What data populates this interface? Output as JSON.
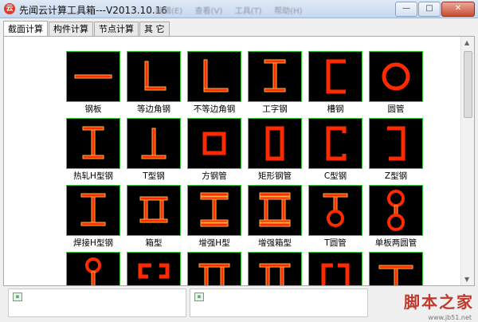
{
  "window": {
    "title": "先闻云计算工具箱---V2013.10.16",
    "menus": [
      "编辑(E)",
      "查看(V)",
      "工具(T)",
      "帮助(H)"
    ],
    "controls": {
      "minimize": "—",
      "maximize": "□",
      "close": "✕"
    }
  },
  "tabs": [
    "截面计算",
    "构件计算",
    "节点计算",
    "其 它"
  ],
  "active_tab": "截面计算",
  "sections": [
    {
      "label": "钢板",
      "icon": "flat-plate-icon"
    },
    {
      "label": "等边角钢",
      "icon": "equal-angle-icon"
    },
    {
      "label": "不等边角钢",
      "icon": "unequal-angle-icon"
    },
    {
      "label": "工字钢",
      "icon": "i-beam-icon"
    },
    {
      "label": "槽钢",
      "icon": "channel-icon"
    },
    {
      "label": "圆管",
      "icon": "round-pipe-icon"
    },
    {
      "label": "热轧H型钢",
      "icon": "hot-rolled-h-icon"
    },
    {
      "label": "T型钢",
      "icon": "t-section-icon"
    },
    {
      "label": "方钢管",
      "icon": "square-tube-icon"
    },
    {
      "label": "矩形钢管",
      "icon": "rect-tube-icon"
    },
    {
      "label": "C型钢",
      "icon": "c-section-icon"
    },
    {
      "label": "Z型钢",
      "icon": "z-section-icon"
    },
    {
      "label": "焊接H型钢",
      "icon": "welded-h-icon"
    },
    {
      "label": "箱型",
      "icon": "box-section-icon"
    },
    {
      "label": "增强H型",
      "icon": "reinforced-h-icon"
    },
    {
      "label": "增强箱型",
      "icon": "reinforced-box-icon"
    },
    {
      "label": "T圆管",
      "icon": "t-round-pipe-icon"
    },
    {
      "label": "单板两圆管",
      "icon": "plate-two-pipes-icon"
    },
    {
      "label": "",
      "icon": "plate-pipe-icon"
    },
    {
      "label": "",
      "icon": "double-channel-icon"
    },
    {
      "label": "",
      "icon": "double-t-icon"
    },
    {
      "label": "",
      "icon": "t-channel-icon"
    },
    {
      "label": "",
      "icon": "c-lipped-icon"
    },
    {
      "label": "",
      "icon": "t-pipe-base-icon"
    }
  ],
  "watermark": {
    "text": "脚本之家",
    "url": "www.jb51.net"
  },
  "colors": {
    "shape_fill": "#ff2a00",
    "shape_outline": "#ffb040",
    "thumb_border": "#33cc33",
    "thumb_bg": "#000000"
  }
}
